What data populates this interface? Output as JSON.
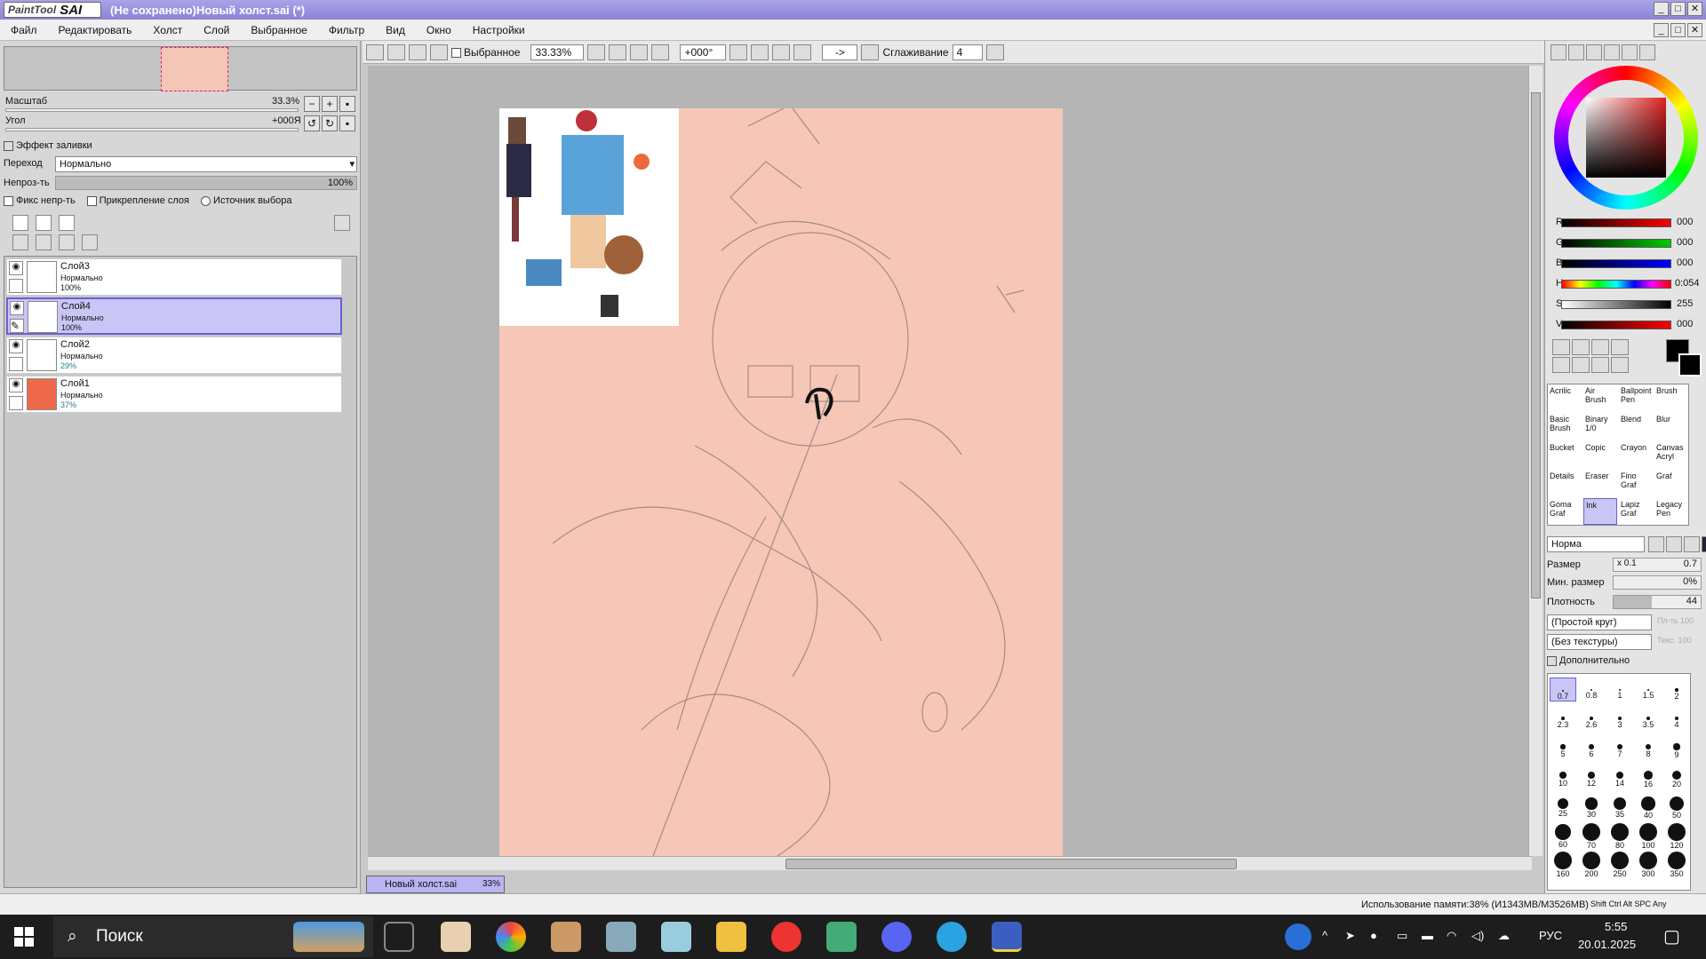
{
  "window": {
    "app_logo": "PaintTool",
    "app_logo_brand": "SAI",
    "title": "(Не сохранено)Новый холст.sai (*)"
  },
  "menu": [
    "Файл",
    "Редактировать",
    "Холст",
    "Слой",
    "Выбранное",
    "Фильтр",
    "Вид",
    "Окно",
    "Настройки"
  ],
  "navigator": {
    "zoom_label": "Масштаб",
    "zoom_value": "33.3%",
    "angle_label": "Угол",
    "angle_value": "+000Я"
  },
  "fill_effect": {
    "label": "Эффект заливки"
  },
  "blend": {
    "label": "Переход",
    "value": "Нормально"
  },
  "opacity": {
    "label": "Непроз-ть",
    "value": "100%",
    "level": 1.0
  },
  "options": {
    "preserve": "Фикс непр-ть",
    "clip": "Прикрепление слоя",
    "source": "Источник выбора"
  },
  "layers": [
    {
      "name": "Слой3",
      "mode": "Нормально",
      "opacity": "100%"
    },
    {
      "name": "Слой4",
      "mode": "Нормально",
      "opacity": "100%"
    },
    {
      "name": "Слой2",
      "mode": "Нормально",
      "opacity": "29%"
    },
    {
      "name": "Слой1",
      "mode": "Нормально",
      "opacity": "37%"
    }
  ],
  "canvas_toolbar": {
    "selection_label": "Выбранное",
    "zoom": "33.33%",
    "angle": "+000°",
    "arrow": "->",
    "smoothing_label": "Сглаживание",
    "smoothing_value": "4"
  },
  "document_tab": {
    "name": "Новый холст.sai",
    "zoom": "33%"
  },
  "colors": {
    "paper": "#f6c7b6",
    "active_layer": "#c9c6f5",
    "title_bar": "#8b84d6",
    "layer1_thumb": "#ee6a4a"
  },
  "color_panel": {
    "r_label": "R",
    "r_value": "000",
    "g_label": "G",
    "g_value": "000",
    "b_label": "B",
    "b_value": "000",
    "h_label": "H",
    "h_value": "0:054",
    "s_label": "S",
    "s_value": "255",
    "v_label": "V",
    "v_value": "000"
  },
  "brushes": [
    [
      "Acrilic",
      "Air Brush",
      "Ballpoint Pen",
      "Brush"
    ],
    [
      "Basic Brush",
      "Binary 1/0",
      "Blend",
      "Blur"
    ],
    [
      "Bucket",
      "Copic",
      "Crayon",
      "Canvas Acryl"
    ],
    [
      "Details",
      "Eraser",
      "Fino Graf",
      "Graf"
    ],
    [
      "Goma Graf",
      "Ink",
      "Lapiz Graf",
      "Legacy Pen"
    ]
  ],
  "brush_settings": {
    "mode": "Норма",
    "size_label": "Размер",
    "size_mult": "x 0.1",
    "size_value": "0.7",
    "min_size_label": "Мин. размер",
    "min_size_value": "0%",
    "density_label": "Плотность",
    "density_value": "44",
    "shape": "(Простой круг)",
    "texture": "(Без текстуры)",
    "shape_strength": "Пл-ть 100",
    "texture_strength": "Текс. 100",
    "advanced_label": "Дополнительно"
  },
  "brush_sizes": [
    "0.7",
    "0.8",
    "1",
    "1.5",
    "2",
    "2.3",
    "2.6",
    "3",
    "3.5",
    "4",
    "5",
    "6",
    "7",
    "8",
    "9",
    "10",
    "12",
    "14",
    "16",
    "20",
    "25",
    "30",
    "35",
    "40",
    "50",
    "60",
    "70",
    "80",
    "100",
    "120",
    "160",
    "200",
    "250",
    "300",
    "350"
  ],
  "status": {
    "memory": "Использование памяти:38% (И1343МВ/М3526МВ)",
    "keys": "Shift Ctrl Alt SPC Any"
  },
  "taskbar": {
    "search": "Поиск",
    "lang": "РУС",
    "time": "5:55",
    "date": "20.01.2025"
  }
}
